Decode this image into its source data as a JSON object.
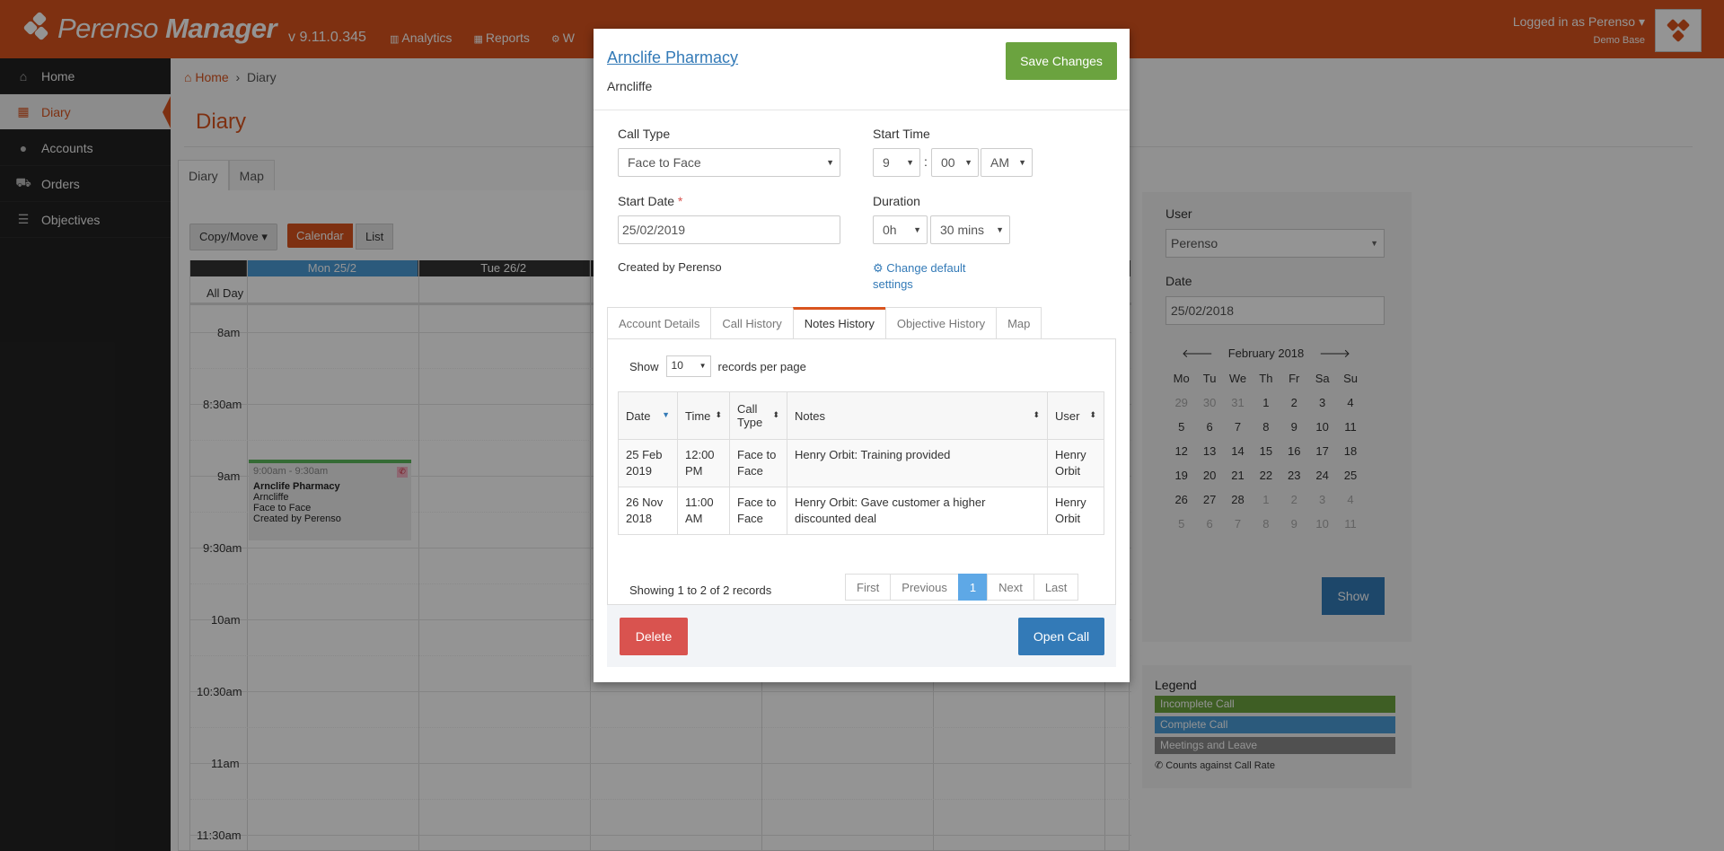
{
  "app": {
    "brand_light": "Perenso",
    "brand_bold": "Manager",
    "version": "v 9.11.0.345",
    "topnav": [
      {
        "label": "Analytics",
        "icon": "bar-chart-icon"
      },
      {
        "label": "Reports",
        "icon": "table-icon"
      },
      {
        "label": "W",
        "icon": "gears-icon"
      }
    ],
    "user": {
      "logged_in": "Logged in as Perenso",
      "database": "Demo Base"
    }
  },
  "sidebar": {
    "items": [
      {
        "label": "Home",
        "icon": "home-icon"
      },
      {
        "label": "Diary",
        "icon": "calendar-icon",
        "active": true
      },
      {
        "label": "Accounts",
        "icon": "users-icon"
      },
      {
        "label": "Orders",
        "icon": "cart-icon"
      },
      {
        "label": "Objectives",
        "icon": "list-icon"
      }
    ]
  },
  "breadcrumb": {
    "home": "Home",
    "current": "Diary"
  },
  "page": {
    "title": "Diary",
    "tabs": [
      "Diary",
      "Map"
    ],
    "copy_move": "Copy/Move",
    "calendar_btn": "Calendar",
    "list_btn": "List"
  },
  "calendar": {
    "days": [
      "Mon 25/2",
      "Tue 26/2"
    ],
    "all_day": "All Day",
    "times": [
      "8am",
      "8:30am",
      "9am",
      "9:30am",
      "10am",
      "10:30am",
      "11am",
      "11:30am"
    ],
    "event": {
      "time": "9:00am - 9:30am",
      "title": "Arnclife Pharmacy",
      "line1": "Arncliffe",
      "line2": "Face to Face",
      "line3": "Created by Perenso"
    }
  },
  "filter_panel": {
    "user_label": "User",
    "user_value": "Perenso",
    "date_label": "Date",
    "date_value": "25/02/2018",
    "month": "February 2018",
    "dow": [
      "Mo",
      "Tu",
      "We",
      "Th",
      "Fr",
      "Sa",
      "Su"
    ],
    "weeks": [
      [
        "29",
        "30",
        "31",
        "1",
        "2",
        "3",
        "4"
      ],
      [
        "5",
        "6",
        "7",
        "8",
        "9",
        "10",
        "11"
      ],
      [
        "12",
        "13",
        "14",
        "15",
        "16",
        "17",
        "18"
      ],
      [
        "19",
        "20",
        "21",
        "22",
        "23",
        "24",
        "25"
      ],
      [
        "26",
        "27",
        "28",
        "1",
        "2",
        "3",
        "4"
      ],
      [
        "5",
        "6",
        "7",
        "8",
        "9",
        "10",
        "11"
      ]
    ],
    "show_btn": "Show"
  },
  "legend": {
    "title": "Legend",
    "items": [
      {
        "label": "Incomplete Call",
        "color": "#6ba33f"
      },
      {
        "label": "Complete Call",
        "color": "#4a9bd6"
      },
      {
        "label": "Meetings and Leave",
        "color": "#8a8a8a"
      }
    ],
    "note": "Counts against Call Rate"
  },
  "modal": {
    "account_name": "Arnclife Pharmacy",
    "account_sub": "Arncliffe",
    "save_btn": "Save Changes",
    "call_type_label": "Call Type",
    "call_type_value": "Face to Face",
    "start_time_label": "Start Time",
    "start_hour": "9",
    "start_minute": "00",
    "start_ampm": "AM",
    "start_date_label": "Start Date",
    "start_date_value": "25/02/2019",
    "duration_label": "Duration",
    "duration_hours": "0h",
    "duration_mins": "30 mins",
    "created_by": "Created by Perenso",
    "change_defaults_1": "Change default",
    "change_defaults_2": "settings",
    "tabs": [
      "Account Details",
      "Call History",
      "Notes History",
      "Objective History",
      "Map"
    ],
    "active_tab": 2,
    "show_label": "Show",
    "page_size": "10",
    "records_per_page": "records per page",
    "columns": {
      "date": "Date",
      "time": "Time",
      "call_type_1": "Call",
      "call_type_2": "Type",
      "notes": "Notes",
      "user": "User"
    },
    "rows": [
      {
        "date1": "25 Feb",
        "date2": "2019",
        "time1": "12:00",
        "time2": "PM",
        "type1": "Face to",
        "type2": "Face",
        "notes1": "Henry Orbit: Training provided",
        "notes2": "",
        "user1": "Henry",
        "user2": "Orbit"
      },
      {
        "date1": "26 Nov",
        "date2": "2018",
        "time1": "11:00",
        "time2": "AM",
        "type1": "Face to",
        "type2": "Face",
        "notes1": "Henry Orbit: Gave customer a higher",
        "notes2": "discounted deal",
        "user1": "Henry",
        "user2": "Orbit"
      }
    ],
    "showing": "Showing 1 to 2 of 2 records",
    "pager": {
      "first": "First",
      "previous": "Previous",
      "current": "1",
      "next": "Next",
      "last": "Last"
    },
    "delete_btn": "Delete",
    "open_btn": "Open Call"
  }
}
